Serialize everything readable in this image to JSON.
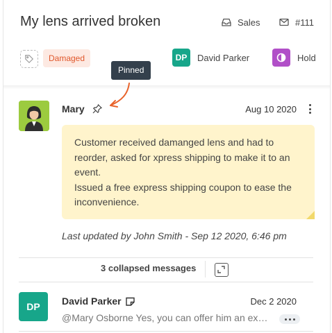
{
  "ticket": {
    "title": "My lens arrived broken",
    "inbox": "Sales",
    "number": "#111",
    "tag": "Damaged",
    "assignee": {
      "initials": "DP",
      "name": "David Parker"
    },
    "status": "Hold"
  },
  "tooltip": "Pinned",
  "pinned_message": {
    "author": "Mary",
    "date": "Aug 10 2020",
    "body": "Customer received damanged lens and had to reorder, asked for xpress shipping to make it to an event.\nIssued a free express shipping coupon to ease the inconvenience.",
    "updated": "Last updated by John Smith - Sep 12 2020, 6:46 pm"
  },
  "collapsed": {
    "label": "3 collapsed messages"
  },
  "last_message": {
    "initials": "DP",
    "author": "David Parker",
    "date": "Dec 2 2020",
    "preview": "@Mary Osborne Yes, you can offer him an express"
  },
  "colors": {
    "accent_green": "#17a68a",
    "status_purple": "#b14fc8",
    "tag_bg": "#fde9e2",
    "tag_text": "#e0572b",
    "note_bg": "#fff4cc",
    "arrow": "#e8622a"
  }
}
